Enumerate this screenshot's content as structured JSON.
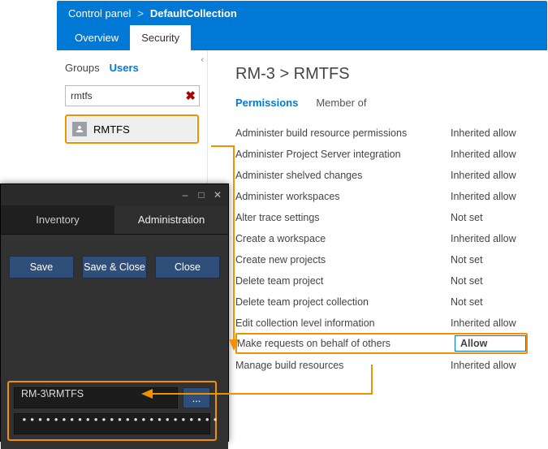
{
  "breadcrumb": {
    "root": "Control panel",
    "collection": "DefaultCollection"
  },
  "header_tabs": {
    "overview": "Overview",
    "security": "Security"
  },
  "sidebar": {
    "groups_label": "Groups",
    "users_label": "Users",
    "search_value": "rmtfs",
    "user_name": "RMTFS"
  },
  "main": {
    "title": "RM-3 > RMTFS",
    "perm_tab": "Permissions",
    "member_tab": "Member of",
    "permissions": [
      {
        "label": "Administer build resource permissions",
        "value": "Inherited allow"
      },
      {
        "label": "Administer Project Server integration",
        "value": "Inherited allow"
      },
      {
        "label": "Administer shelved changes",
        "value": "Inherited allow"
      },
      {
        "label": "Administer workspaces",
        "value": "Inherited allow"
      },
      {
        "label": "Alter trace settings",
        "value": "Not set"
      },
      {
        "label": "Create a workspace",
        "value": "Inherited allow"
      },
      {
        "label": "Create new projects",
        "value": "Not set"
      },
      {
        "label": "Delete team project",
        "value": "Not set"
      },
      {
        "label": "Delete team project collection",
        "value": "Not set"
      },
      {
        "label": "Edit collection level information",
        "value": "Inherited allow"
      },
      {
        "label": "Make requests on behalf of others",
        "value": "Allow"
      },
      {
        "label": "Manage build resources",
        "value": "Inherited allow"
      }
    ]
  },
  "dark": {
    "tab_inventory": "Inventory",
    "tab_admin": "Administration",
    "save": "Save",
    "save_close": "Save & Close",
    "close": "Close",
    "account": "RM-3\\RMTFS",
    "password_mask": "•••••••••••••••••••••••••",
    "browse": "..."
  },
  "colors": {
    "accent": "#0079d6",
    "highlight": "#f29100"
  }
}
